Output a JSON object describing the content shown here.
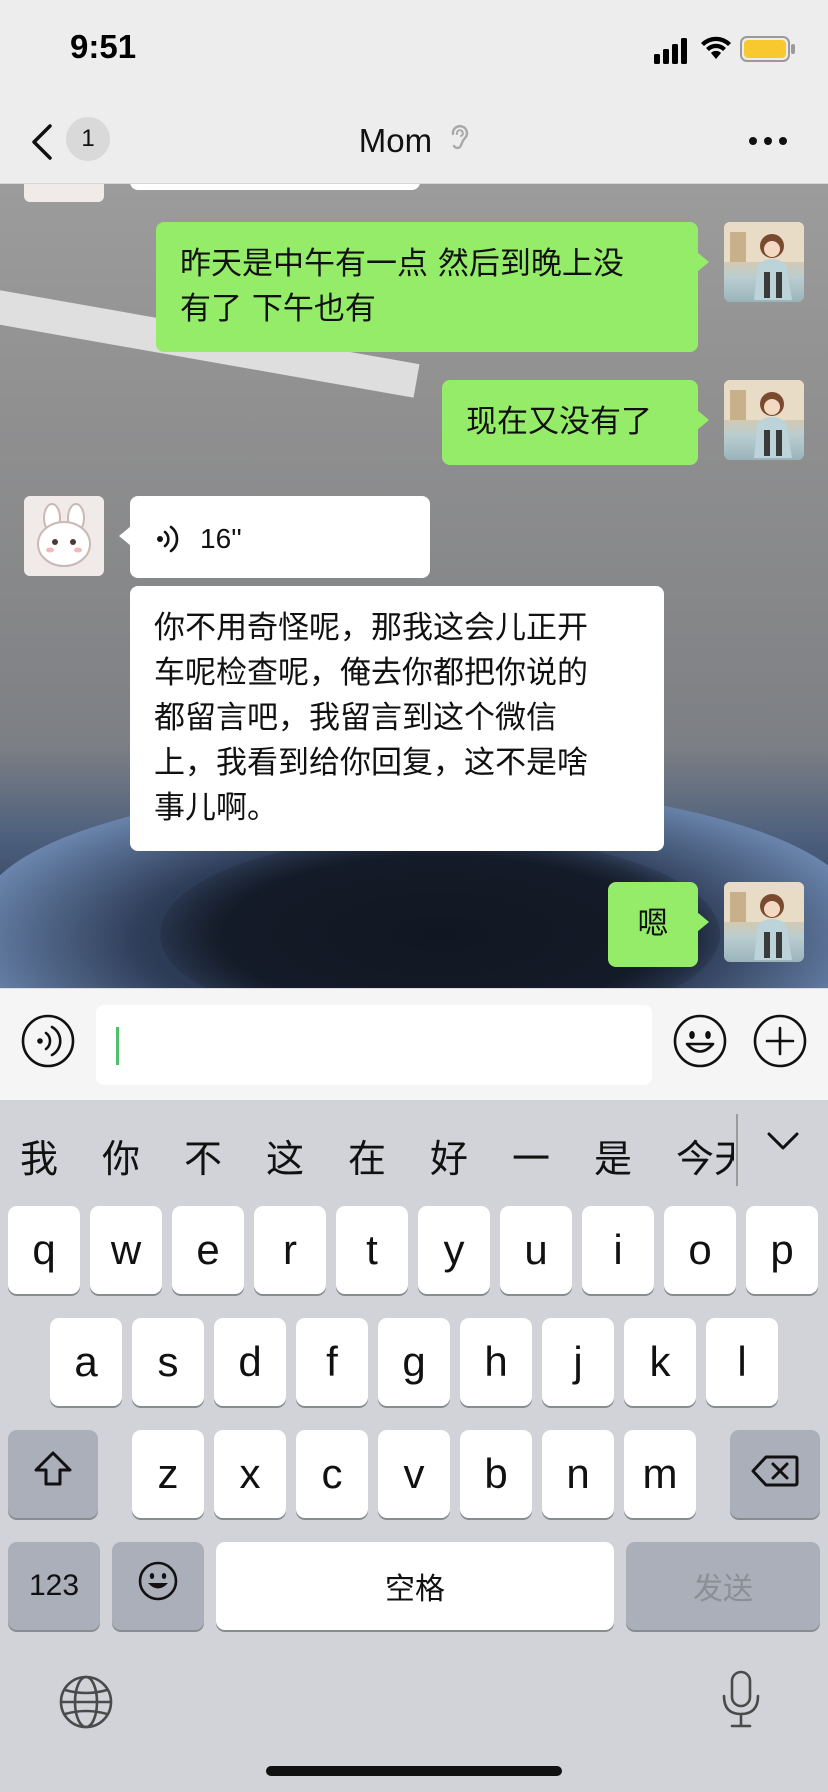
{
  "status_bar": {
    "time": "9:51",
    "icons": [
      "signal-icon",
      "wifi-icon",
      "battery-icon"
    ],
    "battery_color": "#f8c92f"
  },
  "nav": {
    "unread_count": "1",
    "title": "Mom",
    "icons": [
      "back-icon",
      "ear-icon",
      "more-icon"
    ]
  },
  "chat": {
    "messages": [
      {
        "from": "me",
        "type": "text",
        "text": "昨天是中午有一点 然后到晚上没\n有了 下午也有"
      },
      {
        "from": "me",
        "type": "text",
        "text": "现在又没有了"
      },
      {
        "from": "them",
        "type": "voice",
        "duration": "16''"
      },
      {
        "from": "them",
        "type": "text",
        "text": "你不用奇怪呢，那我这会儿正开\n车呢检查呢，俺去你都把你说的\n都留言吧，我留言到这个微信\n上，我看到给你回复，这不是啥\n事儿啊。"
      },
      {
        "from": "me",
        "type": "text",
        "text": "嗯"
      }
    ],
    "colors": {
      "me_bubble": "#95ec69",
      "them_bubble": "#ffffff"
    }
  },
  "input_bar": {
    "value": "",
    "icons": [
      "voice-toggle-icon",
      "emoji-icon",
      "plus-icon"
    ]
  },
  "keyboard": {
    "candidates": [
      "我",
      "你",
      "不",
      "这",
      "在",
      "好",
      "一",
      "是",
      "今天"
    ],
    "row1": [
      "q",
      "w",
      "e",
      "r",
      "t",
      "y",
      "u",
      "i",
      "o",
      "p"
    ],
    "row2": [
      "a",
      "s",
      "d",
      "f",
      "g",
      "h",
      "j",
      "k",
      "l"
    ],
    "row3": [
      "z",
      "x",
      "c",
      "v",
      "b",
      "n",
      "m"
    ],
    "numbers_key": "123",
    "space_key": "空格",
    "send_key": "发送",
    "icons": [
      "shift-icon",
      "backspace-icon",
      "emoji-key-icon",
      "globe-icon",
      "mic-icon",
      "chevron-down-icon"
    ]
  }
}
